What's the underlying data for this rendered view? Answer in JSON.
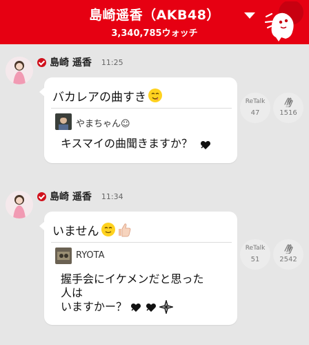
{
  "header": {
    "title": "島崎遥香（AKB48）",
    "watch_count": "3,340,785ウォッチ",
    "dropdown_icon": "caret-down-icon",
    "mascot_icon": "mascot-ghost-icon",
    "colors": {
      "background": "#e60012",
      "text": "#ffffff"
    }
  },
  "posts": [
    {
      "author": "島崎 遥香",
      "time": "11:25",
      "message": "バカレアの曲すき",
      "message_emojis": [
        "yum-face-emoji"
      ],
      "reply": {
        "name": "やまちゃん☺",
        "text_lines": [
          "キスマイの曲聞きますか？"
        ],
        "emojis": [
          "black-heart-emoji"
        ]
      },
      "retalk": {
        "label": "ReTalk",
        "count": "47"
      },
      "clap": {
        "icon": "clap-icon",
        "count": "1516"
      }
    },
    {
      "author": "島崎 遥香",
      "time": "11:34",
      "message": "いません",
      "message_emojis": [
        "smile-face-emoji",
        "thumbs-up-emoji"
      ],
      "reply": {
        "name": "RYOTA",
        "text_lines": [
          "握手会にイケメンだと思った",
          "人は",
          "いますかー？"
        ],
        "emojis": [
          "black-heart-emoji",
          "black-heart-emoji",
          "sparkle-emoji"
        ]
      },
      "retalk": {
        "label": "ReTalk",
        "count": "51"
      },
      "clap": {
        "icon": "clap-icon",
        "count": "2542"
      }
    }
  ]
}
